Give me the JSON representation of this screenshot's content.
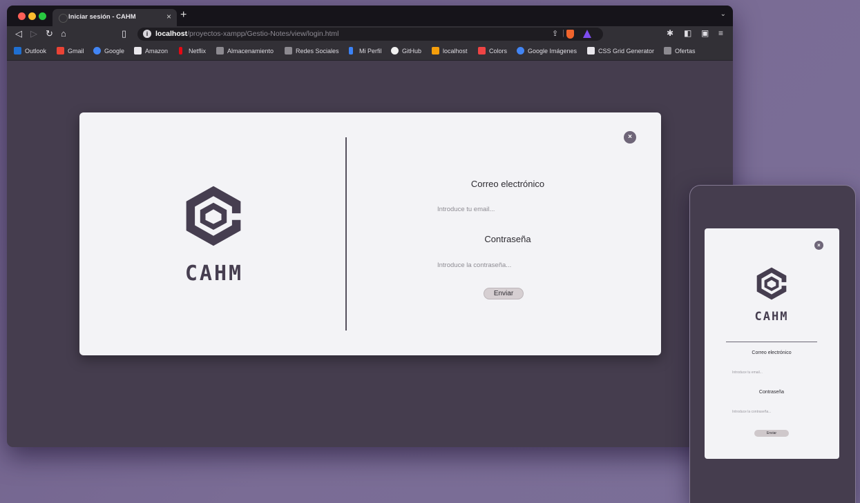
{
  "browser": {
    "tab_title": "Iniciar sesión - CAHM",
    "tab_close": "×",
    "new_tab": "+",
    "url_host": "localhost",
    "url_path": "/proyectos-xampp/Gestio-Notes/view/login.html"
  },
  "bookmarks": [
    {
      "label": "Outlook",
      "icon_color": "#1f6fd1"
    },
    {
      "label": "Gmail",
      "icon_color": "#ea4335"
    },
    {
      "label": "Google",
      "icon_color": "#4285f4"
    },
    {
      "label": "Amazon",
      "icon_color": "#e9e7ec"
    },
    {
      "label": "Netflix",
      "icon_color": "#e50914"
    },
    {
      "label": "Almacenamiento",
      "icon_color": "#8c8a90"
    },
    {
      "label": "Redes Sociales",
      "icon_color": "#8c8a90"
    },
    {
      "label": "Mi Perfil",
      "icon_color": "#3b82f6"
    },
    {
      "label": "GitHub",
      "icon_color": "#f0f0f0"
    },
    {
      "label": "localhost",
      "icon_color": "#f59e0b"
    },
    {
      "label": "Colors",
      "icon_color": "#ef4444"
    },
    {
      "label": "Google Imágenes",
      "icon_color": "#4285f4"
    },
    {
      "label": "CSS Grid Generator",
      "icon_color": "#e9e7ec"
    },
    {
      "label": "Ofertas",
      "icon_color": "#8c8a90"
    }
  ],
  "login": {
    "brand": "CAHM",
    "email_label": "Correo electrónico",
    "email_placeholder": "Introduce tu email...",
    "password_label": "Contraseña",
    "password_placeholder": "Introduce la contraseña...",
    "submit_label": "Enviar",
    "close_symbol": "×"
  },
  "colors": {
    "page_background": "#453d4e",
    "modal_background": "#f3f3f6",
    "brand_color": "#463e50",
    "submit_background": "#d6cfd2"
  }
}
